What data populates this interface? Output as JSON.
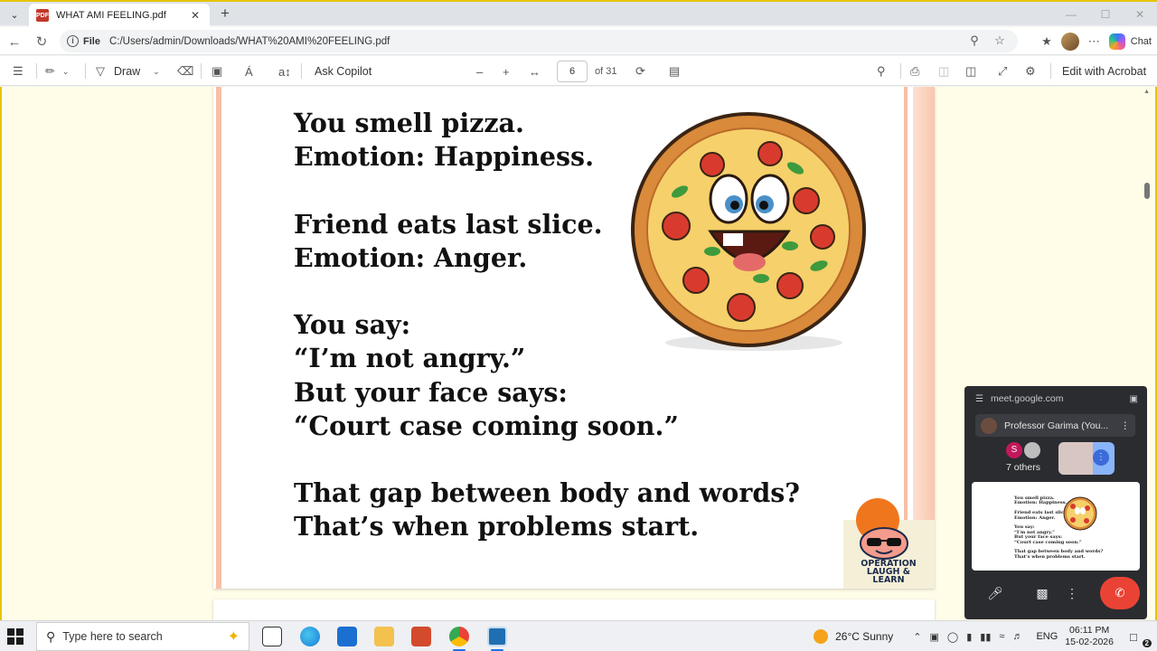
{
  "browser": {
    "tab_title": "WHAT AMI FEELING.pdf",
    "url_scheme": "File",
    "url": "C:/Users/admin/Downloads/WHAT%20AMI%20FEELING.pdf",
    "chat_label": "Chat"
  },
  "pdf_toolbar": {
    "draw_label": "Draw",
    "ask_copilot_label": "Ask Copilot",
    "page_number": "6",
    "page_total": "of 31",
    "edit_label": "Edit with Acrobat"
  },
  "document": {
    "lines": [
      "You smell pizza.",
      "Emotion: Happiness.",
      "",
      "Friend eats last slice.",
      "Emotion: Anger.",
      "",
      "You say:",
      "“I’m not angry.”",
      "But your face says:",
      "“Court case coming soon.”",
      "",
      "That gap between body and words?",
      "That’s when problems start."
    ],
    "brand_text": "OPERATION LAUGH & LEARN"
  },
  "meet": {
    "domain": "meet.google.com",
    "presenter": "Professor Garima (You...",
    "others_initial": "S",
    "others_label": "7 others"
  },
  "taskbar": {
    "search_placeholder": "Type here to search",
    "weather": "26°C  Sunny",
    "lang": "ENG",
    "time": "06:11 PM",
    "date": "15-02-2026",
    "notification_count": "2"
  }
}
